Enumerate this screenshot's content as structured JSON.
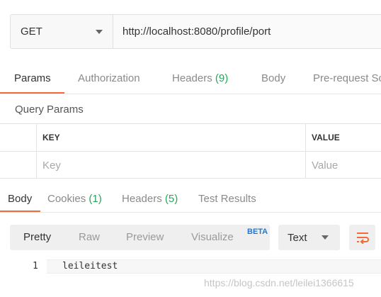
{
  "request": {
    "method": "GET",
    "url": "http://localhost:8080/profile/port"
  },
  "request_tabs": {
    "params": "Params",
    "authorization": "Authorization",
    "headers_label": "Headers",
    "headers_count": "(9)",
    "body": "Body",
    "prerequest": "Pre-request Sc"
  },
  "query_params": {
    "title": "Query Params",
    "columns": {
      "key": "KEY",
      "value": "VALUE"
    },
    "placeholder_row": {
      "key": "Key",
      "value": "Value"
    }
  },
  "response_tabs": {
    "body": "Body",
    "cookies_label": "Cookies",
    "cookies_count": "(1)",
    "headers_label": "Headers",
    "headers_count": "(5)",
    "test_results": "Test Results"
  },
  "format_bar": {
    "pretty": "Pretty",
    "raw": "Raw",
    "preview": "Preview",
    "visualize": "Visualize",
    "beta": "BETA",
    "type_select": "Text",
    "wrap_icon": "wrap-lines-icon"
  },
  "editor": {
    "lines": [
      {
        "number": "1",
        "text": "leileitest"
      }
    ]
  },
  "watermark": "https://blog.csdn.net/leilei1366615",
  "colors": {
    "accent": "#f26b3a",
    "count_green": "#26a65b",
    "beta_blue": "#1f79d1"
  }
}
